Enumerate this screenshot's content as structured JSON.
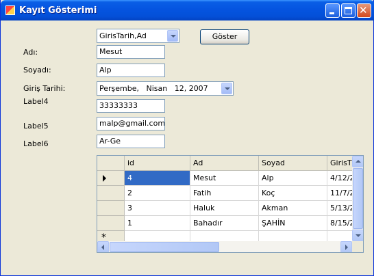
{
  "window": {
    "title": "Kayıt Gösterimi"
  },
  "top": {
    "sort_combo_value": "GirisTarih,Ad",
    "show_button": "Göster"
  },
  "form": {
    "ad_label": "Adı:",
    "ad_value": "Mesut",
    "soyad_label": "Soyadı:",
    "soyad_value": "Alp",
    "giris_label": "Giriş Tarihi:",
    "giris_value": "Perşembe,   Nisan   12, 2007",
    "label4": "Label4",
    "label4_value": "33333333",
    "label5": "Label5",
    "label5_value": "malp@gmail.com",
    "label6": "Label6",
    "label6_value": "Ar-Ge"
  },
  "grid": {
    "columns": [
      "id",
      "Ad",
      "Soyad",
      "GirisT"
    ],
    "rows": [
      [
        "4",
        "Mesut",
        "Alp",
        "4/12/2"
      ],
      [
        "2",
        "Fatih",
        "Koç",
        "11/7/2"
      ],
      [
        "3",
        "Haluk",
        "Akman",
        "5/13/2"
      ],
      [
        "1",
        "Bahadır",
        "ŞAHİN",
        "8/15/2"
      ]
    ],
    "new_row_marker": "*"
  },
  "colors": {
    "title_bar": "#0554e0",
    "selection": "#316ac5",
    "window_bg": "#ece9d8"
  }
}
